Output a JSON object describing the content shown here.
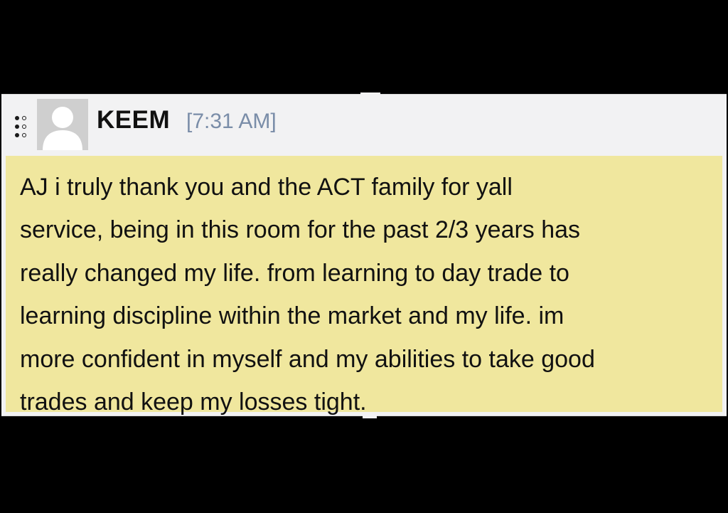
{
  "message": {
    "username": "KEEM",
    "timestamp": "[7:31 AM]",
    "text": "AJ i truly thank you and the ACT family for yall\nservice, being in this room for the past 2/3 years has\nreally changed my life. from learning to day trade to\nlearning discipline within the market and my life. im\nmore confident in myself and my abilities to take good\ntrades and keep my losses tight.",
    "avatar_icon": "default-user-avatar-icon",
    "handle_icon": "drag-handle-icon"
  },
  "colors": {
    "background": "#000000",
    "card": "#f2f2f3",
    "highlight": "#f0e79e",
    "timestamp": "#7a8da8",
    "text": "#111111"
  }
}
